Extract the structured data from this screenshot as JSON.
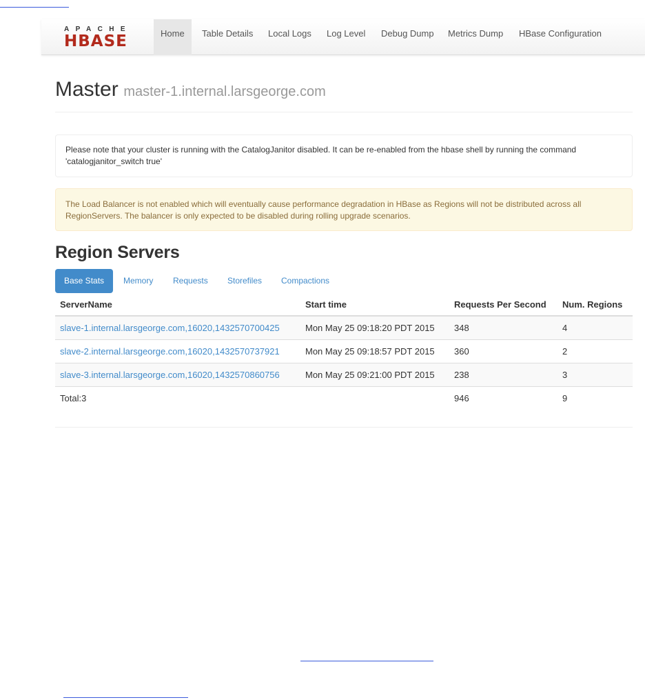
{
  "brand": {
    "top": "APACHE",
    "bottom": "HBASE"
  },
  "nav": {
    "items": [
      {
        "label": "Home"
      },
      {
        "label": "Table Details"
      },
      {
        "label": "Local Logs"
      },
      {
        "label": "Log Level"
      },
      {
        "label": "Debug Dump"
      },
      {
        "label": "Metrics Dump"
      },
      {
        "label": "HBase Configuration"
      }
    ],
    "active": "Home"
  },
  "header": {
    "title": "Master",
    "subtitle": "master-1.internal.larsgeorge.com"
  },
  "notice": {
    "line1": "Please note that your cluster is running with the CatalogJanitor disabled. It can be re-enabled from the hbase shell by running the command",
    "line2": "'catalogjanitor_switch true'"
  },
  "warning": {
    "line1": "The Load Balancer is not enabled which will eventually cause performance degradation in HBase as Regions will not be distributed across all",
    "line2": "RegionServers. The balancer is only expected to be disabled during rolling upgrade scenarios."
  },
  "region_servers": {
    "title": "Region Servers",
    "tabs": [
      "Base Stats",
      "Memory",
      "Requests",
      "Storefiles",
      "Compactions"
    ],
    "active_tab": "Base Stats",
    "columns": [
      "ServerName",
      "Start time",
      "Requests Per Second",
      "Num. Regions"
    ],
    "rows": [
      {
        "server": "slave-1.internal.larsgeorge.com,16020,1432570700425",
        "start": "Mon May 25 09:18:20 PDT 2015",
        "rps": "348",
        "regions": "4"
      },
      {
        "server": "slave-2.internal.larsgeorge.com,16020,1432570737921",
        "start": "Mon May 25 09:18:57 PDT 2015",
        "rps": "360",
        "regions": "2"
      },
      {
        "server": "slave-3.internal.larsgeorge.com,16020,1432570860756",
        "start": "Mon May 25 09:21:00 PDT 2015",
        "rps": "238",
        "regions": "3"
      }
    ],
    "total": {
      "label": "Total:3",
      "rps": "946",
      "regions": "9"
    }
  },
  "colors": {
    "link": "#428bca",
    "brand_red": "#b22a1c",
    "warning_bg": "#fcf8e3",
    "warning_text": "#8a6d3b"
  }
}
